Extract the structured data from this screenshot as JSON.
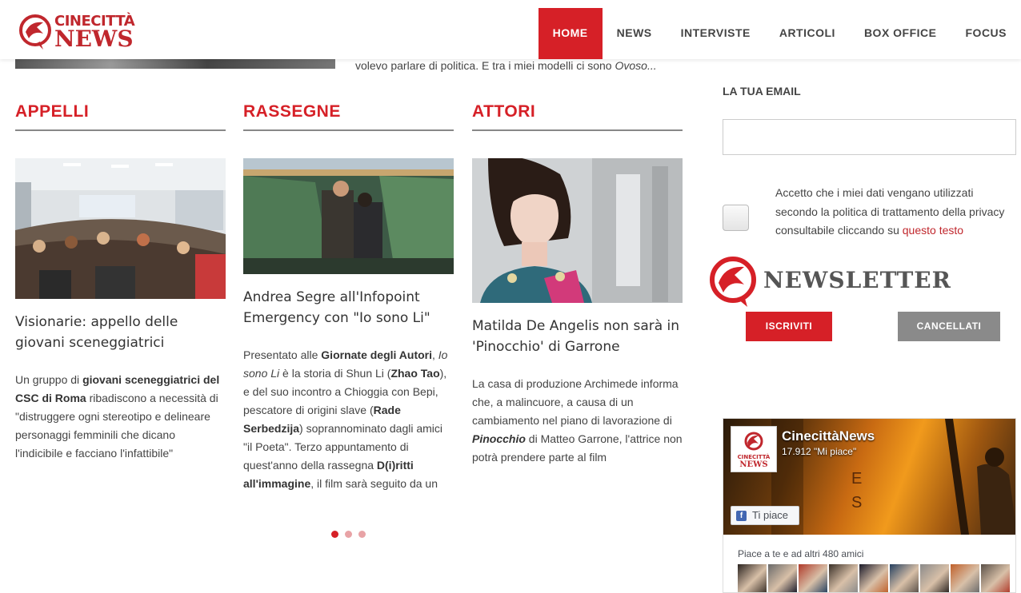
{
  "header": {
    "logo_line1": "CINECITTÀ",
    "logo_line2": "NEWS",
    "nav": [
      {
        "label": "HOME",
        "active": true
      },
      {
        "label": "NEWS"
      },
      {
        "label": "INTERVISTE"
      },
      {
        "label": "ARTICOLI"
      },
      {
        "label": "BOX OFFICE"
      },
      {
        "label": "FOCUS"
      }
    ]
  },
  "top_excerpt": {
    "text": "volevo parlare di politica. E tra i miei modelli ci sono ",
    "italic": "Ovoso..."
  },
  "columns": [
    {
      "title": "APPELLI",
      "headline": "Visionarie: appello delle giovani sceneggiatrici",
      "excerpt_parts": [
        {
          "t": "Un gruppo di "
        },
        {
          "t": "giovani sceneggiatrici del CSC di Roma",
          "b": true
        },
        {
          "t": " ribadiscono a necessità di \"distruggere ogni stereotipo e delineare personaggi femminili che dicano l'indicibile e facciano l'infattibile\""
        }
      ]
    },
    {
      "title": "RASSEGNE",
      "headline": "Andrea Segre all'Infopoint Emergency con \"Io sono Li\"",
      "excerpt_parts": [
        {
          "t": "Presentato alle "
        },
        {
          "t": "Giornate degli Autori",
          "b": true
        },
        {
          "t": ", "
        },
        {
          "t": "Io sono Li",
          "i": true
        },
        {
          "t": " è la storia di Shun Li ("
        },
        {
          "t": "Zhao Tao",
          "b": true
        },
        {
          "t": "), e del suo incontro a Chioggia con Bepi, pescatore di origini slave ("
        },
        {
          "t": "Rade Serbedzija",
          "b": true
        },
        {
          "t": ") soprannominato dagli amici \"il Poeta\". Terzo appuntamento di quest'anno della rassegna "
        },
        {
          "t": "D(i)ritti all'immagine",
          "b": true
        },
        {
          "t": ", il film sarà seguito da un"
        }
      ]
    },
    {
      "title": "ATTORI",
      "headline": "Matilda De Angelis non sarà in 'Pinocchio' di Garrone",
      "excerpt_parts": [
        {
          "t": "La casa di produzione Archimede informa che, a malincuore, a causa di un cambiamento nel piano di lavorazione di "
        },
        {
          "t": "Pinocchio",
          "b": true,
          "i": true
        },
        {
          "t": " di Matteo Garrone, l'attrice non potrà prendere parte al film"
        }
      ]
    }
  ],
  "carousel": {
    "count": 3,
    "active": 0
  },
  "sidebar": {
    "email_label": "LA TUA EMAIL",
    "email_value": "",
    "consent_text": "Accetto che i miei dati vengano utilizzati secondo la politica di trattamento della privacy consultabile cliccando su ",
    "consent_link": "questo testo",
    "newsletter_title": "NEWSLETTER",
    "subscribe_label": "ISCRIVITI",
    "unsubscribe_label": "CANCELLATI"
  },
  "facebook": {
    "page_name": "CinecittàNews",
    "likes": "17.912 \"Mi piace\"",
    "like_button": "Ti piace",
    "thumb_line1": "CINECITTÀ",
    "thumb_line2": "NEWS",
    "cover_letters": [
      "E",
      "S"
    ],
    "friends_text": "Piace a te e ad altri 480 amici",
    "friend_faces": 9
  },
  "colors": {
    "brand_red": "#d62027",
    "nav_text": "#444444",
    "button_gray": "#8a8a8a"
  }
}
